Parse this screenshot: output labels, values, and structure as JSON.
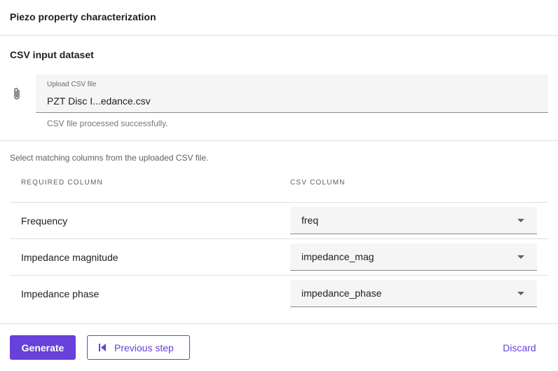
{
  "header": {
    "title": "Piezo property characterization"
  },
  "dataset": {
    "section_title": "CSV input dataset",
    "attach_icon": "paperclip-icon",
    "upload_label": "Upload CSV file",
    "upload_value": "PZT Disc I...edance.csv",
    "upload_hint": "CSV file processed successfully."
  },
  "mapping": {
    "instructions": "Select matching columns from the uploaded CSV file.",
    "headers": {
      "required": "REQUIRED COLUMN",
      "csv": "CSV COLUMN"
    },
    "rows": [
      {
        "label": "Frequency",
        "value": "freq"
      },
      {
        "label": "Impedance magnitude",
        "value": "impedance_mag"
      },
      {
        "label": "Impedance phase",
        "value": "impedance_phase"
      }
    ]
  },
  "actions": {
    "generate": "Generate",
    "previous": "Previous step",
    "discard": "Discard"
  },
  "colors": {
    "accent": "#6741d9",
    "field_bg": "#f5f5f5",
    "divider": "#e0e0e0"
  }
}
